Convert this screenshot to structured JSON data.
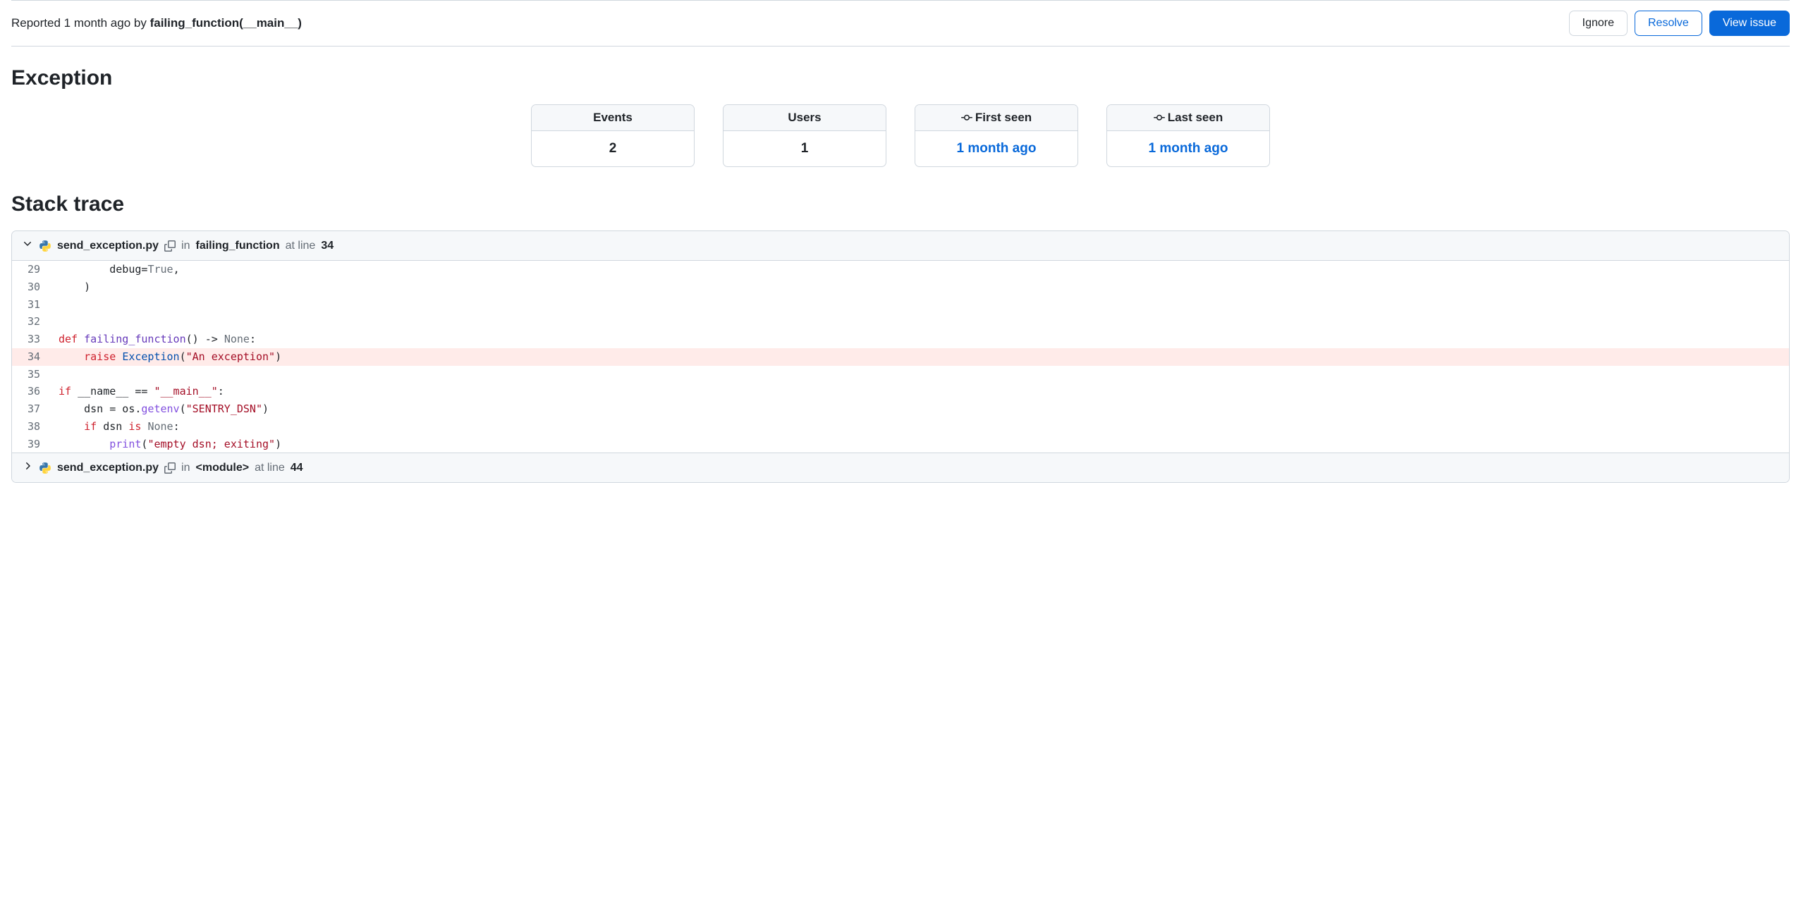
{
  "header": {
    "reported_prefix": "Reported 1 month ago by ",
    "reported_by": "failing_function(__main__)",
    "buttons": {
      "ignore": "Ignore",
      "resolve": "Resolve",
      "view_issue": "View issue"
    }
  },
  "exception": {
    "title": "Exception",
    "stats": [
      {
        "label": "Events",
        "value": "2",
        "icon": false,
        "link": false
      },
      {
        "label": "Users",
        "value": "1",
        "icon": false,
        "link": false
      },
      {
        "label": "First seen",
        "value": "1 month ago",
        "icon": true,
        "link": true
      },
      {
        "label": "Last seen",
        "value": "1 month ago",
        "icon": true,
        "link": true
      }
    ]
  },
  "stacktrace": {
    "title": "Stack trace",
    "frames": [
      {
        "file": "send_exception.py",
        "in_text": "in",
        "function": "failing_function",
        "at_line_text": "at line",
        "line": "34",
        "expanded": true,
        "code": [
          {
            "n": "29",
            "hl": false,
            "tokens": [
              [
                "        debug=",
                ""
              ],
              [
                "True",
                "const"
              ],
              [
                ",",
                ""
              ]
            ]
          },
          {
            "n": "30",
            "hl": false,
            "tokens": [
              [
                "    )",
                ""
              ]
            ]
          },
          {
            "n": "31",
            "hl": false,
            "tokens": [
              [
                "",
                ""
              ]
            ]
          },
          {
            "n": "32",
            "hl": false,
            "tokens": [
              [
                "",
                ""
              ]
            ]
          },
          {
            "n": "33",
            "hl": false,
            "tokens": [
              [
                "def ",
                "kw"
              ],
              [
                "failing_function",
                "fn"
              ],
              [
                "() -> ",
                ""
              ],
              [
                "None",
                "const"
              ],
              [
                ":",
                ""
              ]
            ]
          },
          {
            "n": "34",
            "hl": true,
            "tokens": [
              [
                "    ",
                ""
              ],
              [
                "raise ",
                "kw"
              ],
              [
                "Exception",
                "cls"
              ],
              [
                "(",
                ""
              ],
              [
                "\"An exception\"",
                "strr"
              ],
              [
                ")",
                ""
              ]
            ]
          },
          {
            "n": "35",
            "hl": false,
            "tokens": [
              [
                "",
                ""
              ]
            ]
          },
          {
            "n": "36",
            "hl": false,
            "tokens": [
              [
                "if ",
                "kw"
              ],
              [
                "__name__ == ",
                ""
              ],
              [
                "\"__main__\"",
                "strr"
              ],
              [
                ":",
                ""
              ]
            ]
          },
          {
            "n": "37",
            "hl": false,
            "tokens": [
              [
                "    dsn = os.",
                ""
              ],
              [
                "getenv",
                "call"
              ],
              [
                "(",
                ""
              ],
              [
                "\"SENTRY_DSN\"",
                "strr"
              ],
              [
                ")",
                ""
              ]
            ]
          },
          {
            "n": "38",
            "hl": false,
            "tokens": [
              [
                "    ",
                ""
              ],
              [
                "if ",
                "kw"
              ],
              [
                "dsn ",
                ""
              ],
              [
                "is ",
                "kw"
              ],
              [
                "None",
                "const"
              ],
              [
                ":",
                ""
              ]
            ]
          },
          {
            "n": "39",
            "hl": false,
            "tokens": [
              [
                "        ",
                ""
              ],
              [
                "print",
                "call"
              ],
              [
                "(",
                ""
              ],
              [
                "\"empty dsn; exiting\"",
                "strr"
              ],
              [
                ")",
                ""
              ]
            ]
          }
        ]
      },
      {
        "file": "send_exception.py",
        "in_text": "in",
        "function": "<module>",
        "at_line_text": "at line",
        "line": "44",
        "expanded": false
      }
    ]
  }
}
